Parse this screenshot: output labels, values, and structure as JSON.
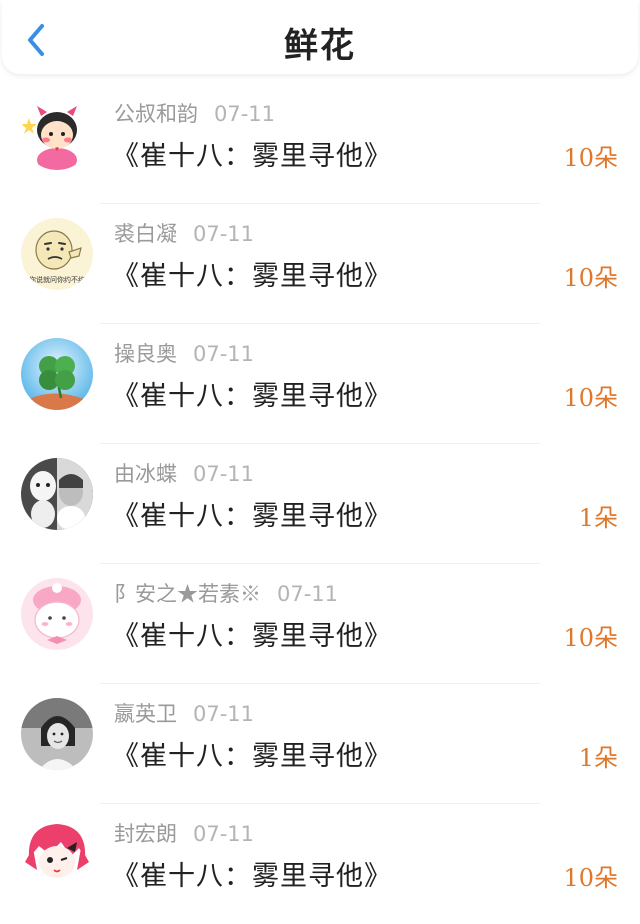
{
  "header": {
    "title": "鲜花",
    "back_icon": "chevron-left-icon",
    "accent_color": "#3a8ee6"
  },
  "flower_color": "#e0782c",
  "items": [
    {
      "user": "公叔和韵",
      "date": "07-11",
      "book": "《崔十八：雾里寻他》",
      "flowers": "10朵",
      "avatar": "cartoon-girl-avatar"
    },
    {
      "user": "裘白凝",
      "date": "07-11",
      "book": "《崔十八：雾里寻他》",
      "flowers": "10朵",
      "avatar": "meme-face-avatar",
      "avatar_text": "你说就问你约不约"
    },
    {
      "user": "操良奥",
      "date": "07-11",
      "book": "《崔十八：雾里寻他》",
      "flowers": "10朵",
      "avatar": "clover-avatar"
    },
    {
      "user": "由冰蝶",
      "date": "07-11",
      "book": "《崔十八：雾里寻他》",
      "flowers": "1朵",
      "avatar": "photo-avatar"
    },
    {
      "user": "阝安之★若素※",
      "date": "07-11",
      "book": "《崔十八：雾里寻他》",
      "flowers": "10朵",
      "avatar": "pink-bunny-avatar"
    },
    {
      "user": "嬴英卫",
      "date": "07-11",
      "book": "《崔十八：雾里寻他》",
      "flowers": "1朵",
      "avatar": "bw-photo-avatar"
    },
    {
      "user": "封宏朗",
      "date": "07-11",
      "book": "《崔十八：雾里寻他》",
      "flowers": "10朵",
      "avatar": "pink-anime-avatar"
    }
  ]
}
